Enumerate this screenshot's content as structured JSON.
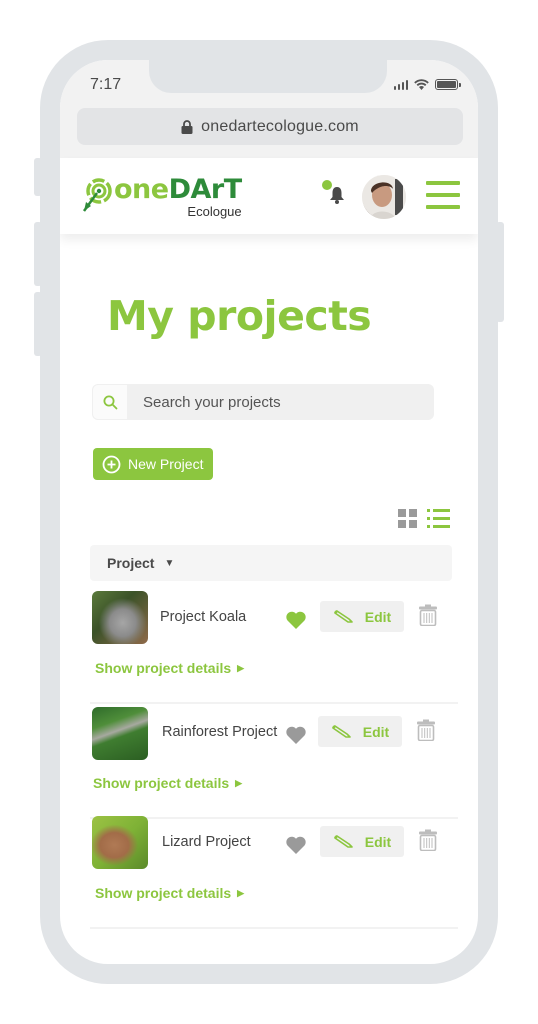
{
  "status_bar": {
    "time": "7:17",
    "icons": [
      "signal-icon",
      "wifi-icon",
      "battery-icon"
    ]
  },
  "browser": {
    "url": "onedartecologue.com",
    "lock_icon": "lock-icon"
  },
  "header": {
    "logo_one": "one",
    "logo_dart": "DArT",
    "logo_sub": "Ecologue",
    "notification_icon": "bell-icon",
    "menu_icon": "hamburger-menu-icon"
  },
  "page": {
    "title": "My projects",
    "search_placeholder": "Search your projects",
    "new_project_label": "New Project",
    "view_modes": [
      {
        "name": "grid",
        "active": false
      },
      {
        "name": "list",
        "active": true
      }
    ],
    "table_header": "Project",
    "sort_indicator": "▼"
  },
  "projects": [
    {
      "name": "Project Koala",
      "thumbnail": "koala",
      "favorite": true,
      "edit_label": "Edit",
      "details_label": "Show project details",
      "details_caret": "▶"
    },
    {
      "name": "Rainforest Project",
      "thumbnail": "rainforest",
      "favorite": false,
      "edit_label": "Edit",
      "details_label": "Show project details",
      "details_caret": "▶"
    },
    {
      "name": "Lizard Project",
      "thumbnail": "lizard",
      "favorite": false,
      "edit_label": "Edit",
      "details_label": "Show project details",
      "details_caret": "▶"
    }
  ],
  "colors": {
    "brand_green": "#8cc63f",
    "brand_dark_green": "#2e8b3a",
    "favorite_off": "#9a9a9a",
    "text": "#444444"
  }
}
